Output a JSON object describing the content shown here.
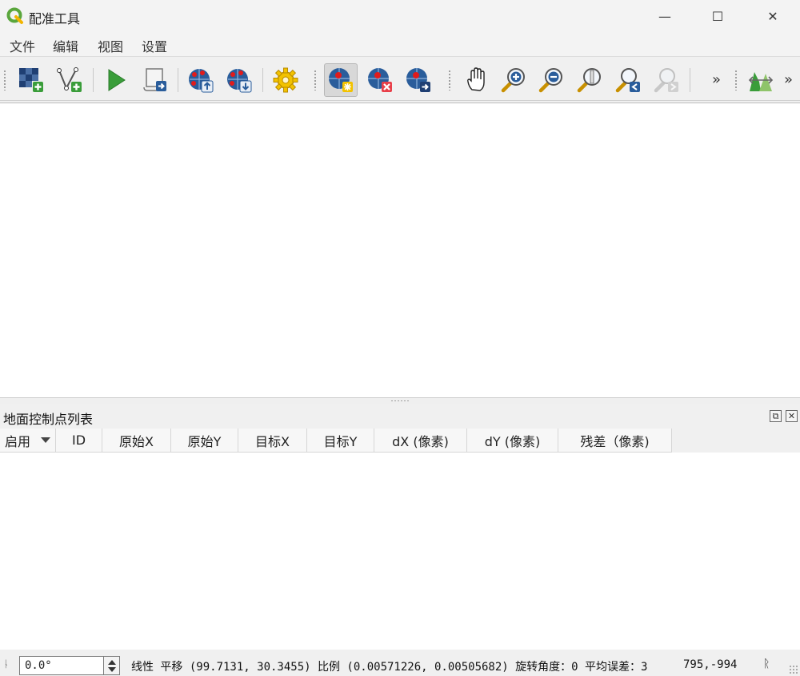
{
  "window": {
    "title": "配准工具",
    "minimize_glyph": "—",
    "maximize_glyph": "☐",
    "close_glyph": "✕"
  },
  "menu": {
    "items": [
      {
        "label": "文件"
      },
      {
        "label": "编辑"
      },
      {
        "label": "视图"
      },
      {
        "label": "设置"
      }
    ]
  },
  "toolbar": {
    "buttons": [
      {
        "icon": "open-raster-icon"
      },
      {
        "icon": "open-vector-icon"
      },
      {
        "icon": "start-georeferencing-icon"
      },
      {
        "icon": "generate-gdal-script-icon"
      },
      {
        "icon": "load-gcp-points-icon"
      },
      {
        "icon": "save-gcp-points-icon"
      },
      {
        "icon": "transformation-settings-icon"
      },
      {
        "icon": "add-point-icon",
        "active": true
      },
      {
        "icon": "delete-point-icon"
      },
      {
        "icon": "move-gcp-point-icon"
      },
      {
        "icon": "pan-icon"
      },
      {
        "icon": "zoom-in-icon"
      },
      {
        "icon": "zoom-out-icon"
      },
      {
        "icon": "zoom-to-layer-icon"
      },
      {
        "icon": "zoom-last-icon"
      },
      {
        "icon": "zoom-next-icon",
        "disabled": true
      },
      {
        "icon": "link-georeferencer-icon"
      }
    ],
    "overflow_glyph": "»"
  },
  "gcp_panel": {
    "title": "地面控制点列表",
    "float_glyph": "⧉",
    "close_glyph": "✕",
    "columns": [
      {
        "label": "启用"
      },
      {
        "label": "ID"
      },
      {
        "label": "原始X"
      },
      {
        "label": "原始Y"
      },
      {
        "label": "目标X"
      },
      {
        "label": "目标Y"
      },
      {
        "label": "dX (像素)"
      },
      {
        "label": "dY (像素)"
      },
      {
        "label": "残差（像素)"
      }
    ]
  },
  "status": {
    "grip_text": "ᚿ",
    "rotation_value": "0.0°",
    "transform_text": "线性 平移 (99.7131, 30.3455) 比例 (0.00571226, 0.00505682) 旋转角度：0 平均误差：3",
    "coordinates": "795,-994",
    "crs_glyph": "ᚱ"
  },
  "colors": {
    "accent_green": "#3a9d3a",
    "gcp_red": "#e11b1b",
    "globe_blue": "#2a5d9b"
  }
}
